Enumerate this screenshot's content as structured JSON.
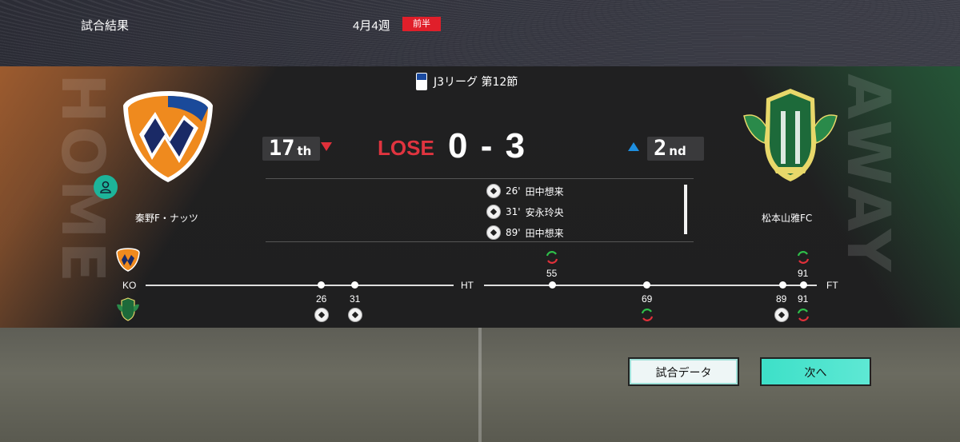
{
  "header": {
    "title": "試合結果",
    "week": "4月4週",
    "half": "前半"
  },
  "match": {
    "league": "J3リーグ 第12節",
    "home_text": "HOME",
    "away_text": "AWAY",
    "home": {
      "name": "秦野F・ナッツ",
      "rank": "17",
      "rank_suffix": "th",
      "rank_trend": "down"
    },
    "away": {
      "name": "松本山雅FC",
      "rank": "2",
      "rank_suffix": "nd",
      "rank_trend": "up"
    },
    "result": "LOSE",
    "score": "0 - 3",
    "goals": [
      {
        "minute": "26'",
        "player": "田中想来"
      },
      {
        "minute": "31'",
        "player": "安永玲央"
      },
      {
        "minute": "89'",
        "player": "田中想来"
      }
    ]
  },
  "timeline": {
    "ko": "KO",
    "ht": "HT",
    "ft": "FT",
    "events": [
      {
        "minute": "26",
        "team": "away",
        "type": "goal"
      },
      {
        "minute": "31",
        "team": "away",
        "type": "goal"
      },
      {
        "minute": "55",
        "team": "home",
        "type": "substitution"
      },
      {
        "minute": "69",
        "team": "away",
        "type": "substitution"
      },
      {
        "minute": "89",
        "team": "away",
        "type": "goal"
      },
      {
        "minute": "91",
        "team": "home",
        "type": "substitution"
      },
      {
        "minute": "91",
        "team": "away",
        "type": "substitution"
      }
    ]
  },
  "buttons": {
    "match_data": "試合データ",
    "next": "次へ"
  },
  "colors": {
    "lose": "#e0343f",
    "home_accent": "#d67634",
    "away_accent": "#287846",
    "next_button": "#3de0c8"
  }
}
